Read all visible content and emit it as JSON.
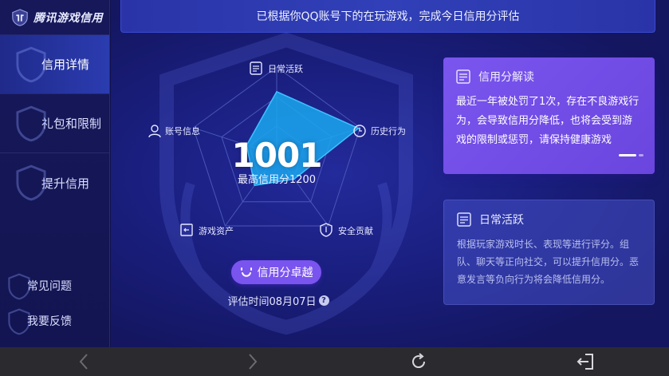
{
  "brand": {
    "name": "腾讯游戏信用"
  },
  "sidebar": {
    "items": [
      {
        "label": "信用详情",
        "active": true
      },
      {
        "label": "礼包和限制",
        "active": false
      },
      {
        "label": "提升信用",
        "active": false
      }
    ],
    "bottom_items": [
      {
        "label": "常见问题"
      },
      {
        "label": "我要反馈"
      }
    ]
  },
  "banner": {
    "text": "已根据你QQ账号下的在玩游戏，完成今日信用分评估"
  },
  "radar": {
    "axes": [
      {
        "label": "日常活跃",
        "icon": "document-icon"
      },
      {
        "label": "历史行为",
        "icon": "clock-icon"
      },
      {
        "label": "安全贡献",
        "icon": "shield-icon"
      },
      {
        "label": "游戏资产",
        "icon": "exit-icon"
      },
      {
        "label": "账号信息",
        "icon": "user-icon"
      }
    ],
    "values": [
      0.72,
      0.98,
      0.34,
      0.43,
      0.36
    ],
    "fill_color": "#1aa7ee"
  },
  "score": {
    "value": "1001",
    "max_label": "最高信用分1200"
  },
  "level_button": {
    "label": "信用分卓越",
    "color": "#7a54ee"
  },
  "eval_time": {
    "text": "评估时间08月07日"
  },
  "cards": [
    {
      "title": "信用分解读",
      "body": "最近一年被处罚了1次，存在不良游戏行为，会导致信用分降低，也将会受到游戏的限制或惩罚，请保持健康游戏",
      "color": "#7a55ee"
    },
    {
      "title": "日常活跃",
      "body": "根据玩家游戏时长、表现等进行评分。组队、聊天等正向社交，可以提升信用分。恶意发言等负向行为将会降低信用分。"
    }
  ],
  "bottom_bar": {
    "buttons": [
      "back-icon",
      "forward-icon",
      "refresh-icon",
      "exit-icon"
    ]
  }
}
